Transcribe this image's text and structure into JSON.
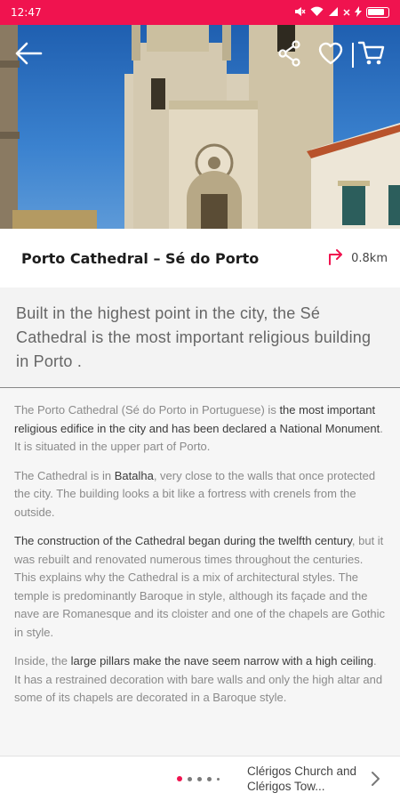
{
  "status_bar": {
    "time": "12:47",
    "icons": [
      "mute-icon",
      "wifi-icon",
      "signal-icon",
      "x-icon",
      "charging-icon",
      "battery-icon"
    ]
  },
  "hero": {
    "image_subject": "Porto Cathedral facade photo"
  },
  "header": {
    "back_icon": "arrow-left-icon",
    "share_icon": "share-icon",
    "favorite_icon": "heart-icon",
    "cart_icon": "cart-icon"
  },
  "place": {
    "title": "Porto Cathedral – Sé do Porto",
    "distance": "0.8km",
    "distance_icon": "turn-right-arrow-icon",
    "accent_color": "#f0134f"
  },
  "summary": "Built in the highest point in the city,  the Sé Cathedral is the most important religious building in Porto .",
  "body": {
    "p1": {
      "a": "The Porto Cathedral (Sé do Porto in Portuguese) is ",
      "b": "the most important religious edifice in the city and has been declared a National Monument",
      "c": ". It is situated in the upper part of Porto."
    },
    "p2": {
      "a": "The Cathedral is in ",
      "b": "Batalha",
      "c": ", very close to the walls that once protected the city. The building looks a bit like a fortress with crenels from the outside."
    },
    "p3": {
      "a": "The construction of the Cathedral began during the twelfth century",
      "b": ", but it was rebuilt and renovated numerous times throughout the centuries. This explains why the Cathedral is a mix of architectural styles. The temple is predominantly Baroque in style, although its façade and the nave are Romanesque and its cloister and one of the chapels are Gothic in style."
    },
    "p4": {
      "a": "Inside, the ",
      "b": "large pillars make the nave seem narrow with a high ceiling",
      "c": ". It has a restrained decoration with bare walls and only the high altar and some of its chapels are decorated in a Baroque style."
    }
  },
  "footer": {
    "pager_total": 5,
    "pager_active": 1,
    "next_place": "Clérigos Church and Clérigos Tow...",
    "next_icon": "chevron-right-icon"
  }
}
